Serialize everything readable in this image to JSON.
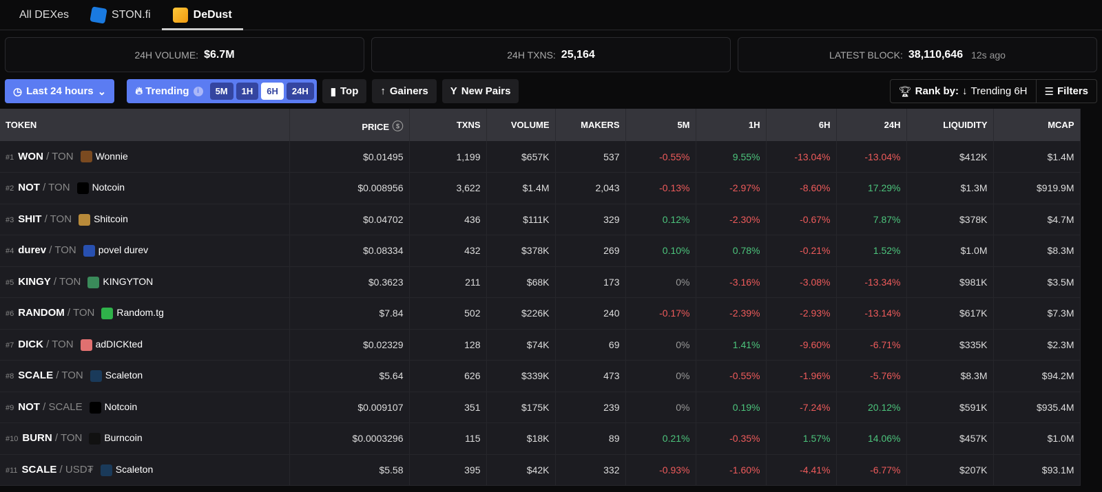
{
  "tabs": [
    {
      "label": "All DEXes"
    },
    {
      "label": "STON.fi"
    },
    {
      "label": "DeDust"
    }
  ],
  "stats": {
    "volume_label": "24H VOLUME:",
    "volume": "$6.7M",
    "txns_label": "24H TXNS:",
    "txns": "25,164",
    "block_label": "LATEST BLOCK:",
    "block": "38,110,646",
    "block_ago": "12s ago"
  },
  "filters": {
    "time": "Last 24 hours",
    "trending": "Trending",
    "intervals": [
      "5M",
      "1H",
      "6H",
      "24H"
    ],
    "selected_interval": "6H",
    "top": "Top",
    "gainers": "Gainers",
    "new_pairs": "New Pairs",
    "rank_label": "Rank by:",
    "rank_value": "Trending 6H",
    "filters_label": "Filters"
  },
  "colors": {
    "accent": "#5b7cf2",
    "negative": "#ef5b5b",
    "positive": "#4cc47c"
  },
  "table": {
    "headers": [
      "TOKEN",
      "PRICE",
      "TXNS",
      "VOLUME",
      "MAKERS",
      "5M",
      "1H",
      "6H",
      "24H",
      "LIQUIDITY",
      "MCAP"
    ],
    "rows": [
      {
        "rank": "#1",
        "base": "WON",
        "quote": "TON",
        "name": "Wonnie",
        "icon": "#7a4a20",
        "price": "$0.01495",
        "txns": "1,199",
        "volume": "$657K",
        "makers": "537",
        "m5": "-0.55%",
        "h1": "9.55%",
        "h6": "-13.04%",
        "h24": "-13.04%",
        "liq": "$412K",
        "mcap": "$1.4M"
      },
      {
        "rank": "#2",
        "base": "NOT",
        "quote": "TON",
        "name": "Notcoin",
        "icon": "#000000",
        "price": "$0.008956",
        "txns": "3,622",
        "volume": "$1.4M",
        "makers": "2,043",
        "m5": "-0.13%",
        "h1": "-2.97%",
        "h6": "-8.60%",
        "h24": "17.29%",
        "liq": "$1.3M",
        "mcap": "$919.9M"
      },
      {
        "rank": "#3",
        "base": "SHIT",
        "quote": "TON",
        "name": "Shitcoin",
        "icon": "#b88a3a",
        "price": "$0.04702",
        "txns": "436",
        "volume": "$111K",
        "makers": "329",
        "m5": "0.12%",
        "h1": "-2.30%",
        "h6": "-0.67%",
        "h24": "7.87%",
        "liq": "$378K",
        "mcap": "$4.7M"
      },
      {
        "rank": "#4",
        "base": "durev",
        "quote": "TON",
        "name": "povel durev",
        "icon": "#2850b0",
        "price": "$0.08334",
        "txns": "432",
        "volume": "$378K",
        "makers": "269",
        "m5": "0.10%",
        "h1": "0.78%",
        "h6": "-0.21%",
        "h24": "1.52%",
        "liq": "$1.0M",
        "mcap": "$8.3M"
      },
      {
        "rank": "#5",
        "base": "KINGY",
        "quote": "TON",
        "name": "KINGYTON",
        "icon": "#3a8a5a",
        "price": "$0.3623",
        "txns": "211",
        "volume": "$68K",
        "makers": "173",
        "m5": "0%",
        "h1": "-3.16%",
        "h6": "-3.08%",
        "h24": "-13.34%",
        "liq": "$981K",
        "mcap": "$3.5M"
      },
      {
        "rank": "#6",
        "base": "RANDOM",
        "quote": "TON",
        "name": "Random.tg",
        "icon": "#2fb24a",
        "price": "$7.84",
        "txns": "502",
        "volume": "$226K",
        "makers": "240",
        "m5": "-0.17%",
        "h1": "-2.39%",
        "h6": "-2.93%",
        "h24": "-13.14%",
        "liq": "$617K",
        "mcap": "$7.3M"
      },
      {
        "rank": "#7",
        "base": "DICK",
        "quote": "TON",
        "name": "adDICKted",
        "icon": "#e07070",
        "price": "$0.02329",
        "txns": "128",
        "volume": "$74K",
        "makers": "69",
        "m5": "0%",
        "h1": "1.41%",
        "h6": "-9.60%",
        "h24": "-6.71%",
        "liq": "$335K",
        "mcap": "$2.3M"
      },
      {
        "rank": "#8",
        "base": "SCALE",
        "quote": "TON",
        "name": "Scaleton",
        "icon": "#1a3a5a",
        "price": "$5.64",
        "txns": "626",
        "volume": "$339K",
        "makers": "473",
        "m5": "0%",
        "h1": "-0.55%",
        "h6": "-1.96%",
        "h24": "-5.76%",
        "liq": "$8.3M",
        "mcap": "$94.2M"
      },
      {
        "rank": "#9",
        "base": "NOT",
        "quote": "SCALE",
        "name": "Notcoin",
        "icon": "#000000",
        "price": "$0.009107",
        "txns": "351",
        "volume": "$175K",
        "makers": "239",
        "m5": "0%",
        "h1": "0.19%",
        "h6": "-7.24%",
        "h24": "20.12%",
        "liq": "$591K",
        "mcap": "$935.4M"
      },
      {
        "rank": "#10",
        "base": "BURN",
        "quote": "TON",
        "name": "Burncoin",
        "icon": "#111111",
        "price": "$0.0003296",
        "txns": "115",
        "volume": "$18K",
        "makers": "89",
        "m5": "0.21%",
        "h1": "-0.35%",
        "h6": "1.57%",
        "h24": "14.06%",
        "liq": "$457K",
        "mcap": "$1.0M"
      },
      {
        "rank": "#11",
        "base": "SCALE",
        "quote": "USD₮",
        "name": "Scaleton",
        "icon": "#1a3a5a",
        "price": "$5.58",
        "txns": "395",
        "volume": "$42K",
        "makers": "332",
        "m5": "-0.93%",
        "h1": "-1.60%",
        "h6": "-4.41%",
        "h24": "-6.77%",
        "liq": "$207K",
        "mcap": "$93.1M"
      }
    ]
  }
}
